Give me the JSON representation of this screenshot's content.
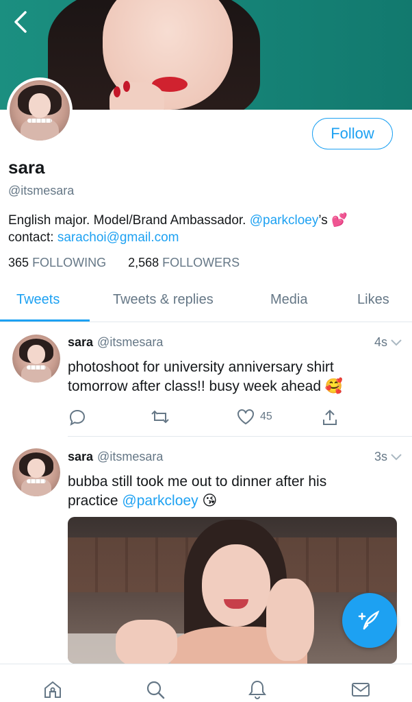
{
  "profile": {
    "name": "sara",
    "handle": "@itsmesara",
    "follow_label": "Follow",
    "bio": {
      "line1_prefix": "English major. Model/Brand Ambassador. ",
      "line1_mention": "@parkcloey",
      "line1_suffix": "’s 💕",
      "line2_prefix": "contact: ",
      "line2_email": "sarachoi@gmail.com"
    },
    "following_count": "365",
    "following_label": "FOLLOWING",
    "followers_count": "2,568",
    "followers_label": "FOLLOWERS"
  },
  "tabs": {
    "tweets": "Tweets",
    "replies": "Tweets & replies",
    "media": "Media",
    "likes": "Likes"
  },
  "tweets": [
    {
      "name": "sara",
      "handle": "@itsmesara",
      "time": "4s",
      "text_line1": "photoshoot for university anniversary shirt",
      "text_line2": "tomorrow after class!! busy week ahead 🥰",
      "likes": "45"
    },
    {
      "name": "sara",
      "handle": "@itsmesara",
      "time": "3s",
      "text_line1": "bubba still took me out to dinner after his",
      "text_line2_prefix": "practice ",
      "text_mention": "@parkcloey",
      "text_line2_suffix": " 😘"
    }
  ],
  "colors": {
    "accent": "#1da1f2",
    "secondary_text": "#657786",
    "divider": "#e1e8ed"
  },
  "icons": {
    "back": "chevron-left-icon",
    "reply": "reply-icon",
    "retweet": "retweet-icon",
    "like": "heart-icon",
    "share": "share-icon",
    "compose": "compose-icon",
    "home": "home-icon",
    "search": "search-icon",
    "notifications": "bell-icon",
    "messages": "mail-icon"
  }
}
